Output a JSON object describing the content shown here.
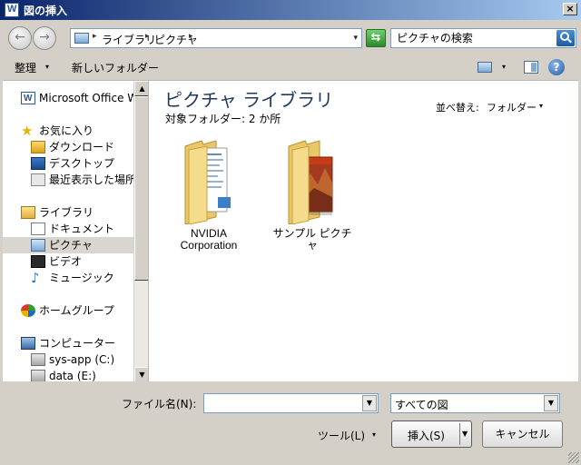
{
  "window": {
    "title": "図の挿入",
    "close_label": "×"
  },
  "address": {
    "crumbs": [
      "ライブラリ",
      "ピクチャ"
    ],
    "separator": "▸",
    "dropdown": "▾",
    "search_placeholder": "ピクチャの検索"
  },
  "toolbar": {
    "organize_label": "整理",
    "new_folder_label": "新しいフォルダー",
    "dropdown": "▾",
    "help_label": "?"
  },
  "nav": {
    "items": [
      {
        "label": "Microsoft Office Wo"
      },
      {
        "label": "お気に入り"
      },
      {
        "label": "ダウンロード"
      },
      {
        "label": "デスクトップ"
      },
      {
        "label": "最近表示した場所"
      },
      {
        "label": "ライブラリ"
      },
      {
        "label": "ドキュメント"
      },
      {
        "label": "ピクチャ"
      },
      {
        "label": "ビデオ"
      },
      {
        "label": "ミュージック"
      },
      {
        "label": "ホームグループ"
      },
      {
        "label": "コンピューター"
      },
      {
        "label": "sys-app (C:)"
      },
      {
        "label": "data (E:)"
      }
    ],
    "selected_index": 7,
    "scroll_up": "▲",
    "scroll_down": "▼"
  },
  "content": {
    "title": "ピクチャ ライブラリ",
    "subtitle": "対象フォルダー: 2 か所",
    "sort_label": "並べ替え:",
    "sort_value": "フォルダー",
    "folders": [
      {
        "label": "NVIDIA Corporation"
      },
      {
        "label": "サンプル ピクチャ"
      }
    ]
  },
  "footer": {
    "filename_label": "ファイル名(N):",
    "filename_value": "",
    "filetype_value": "すべての図",
    "tools_label": "ツール(L)",
    "insert_label": "挿入(S)",
    "cancel_label": "キャンセル",
    "dropdown": "▼"
  }
}
